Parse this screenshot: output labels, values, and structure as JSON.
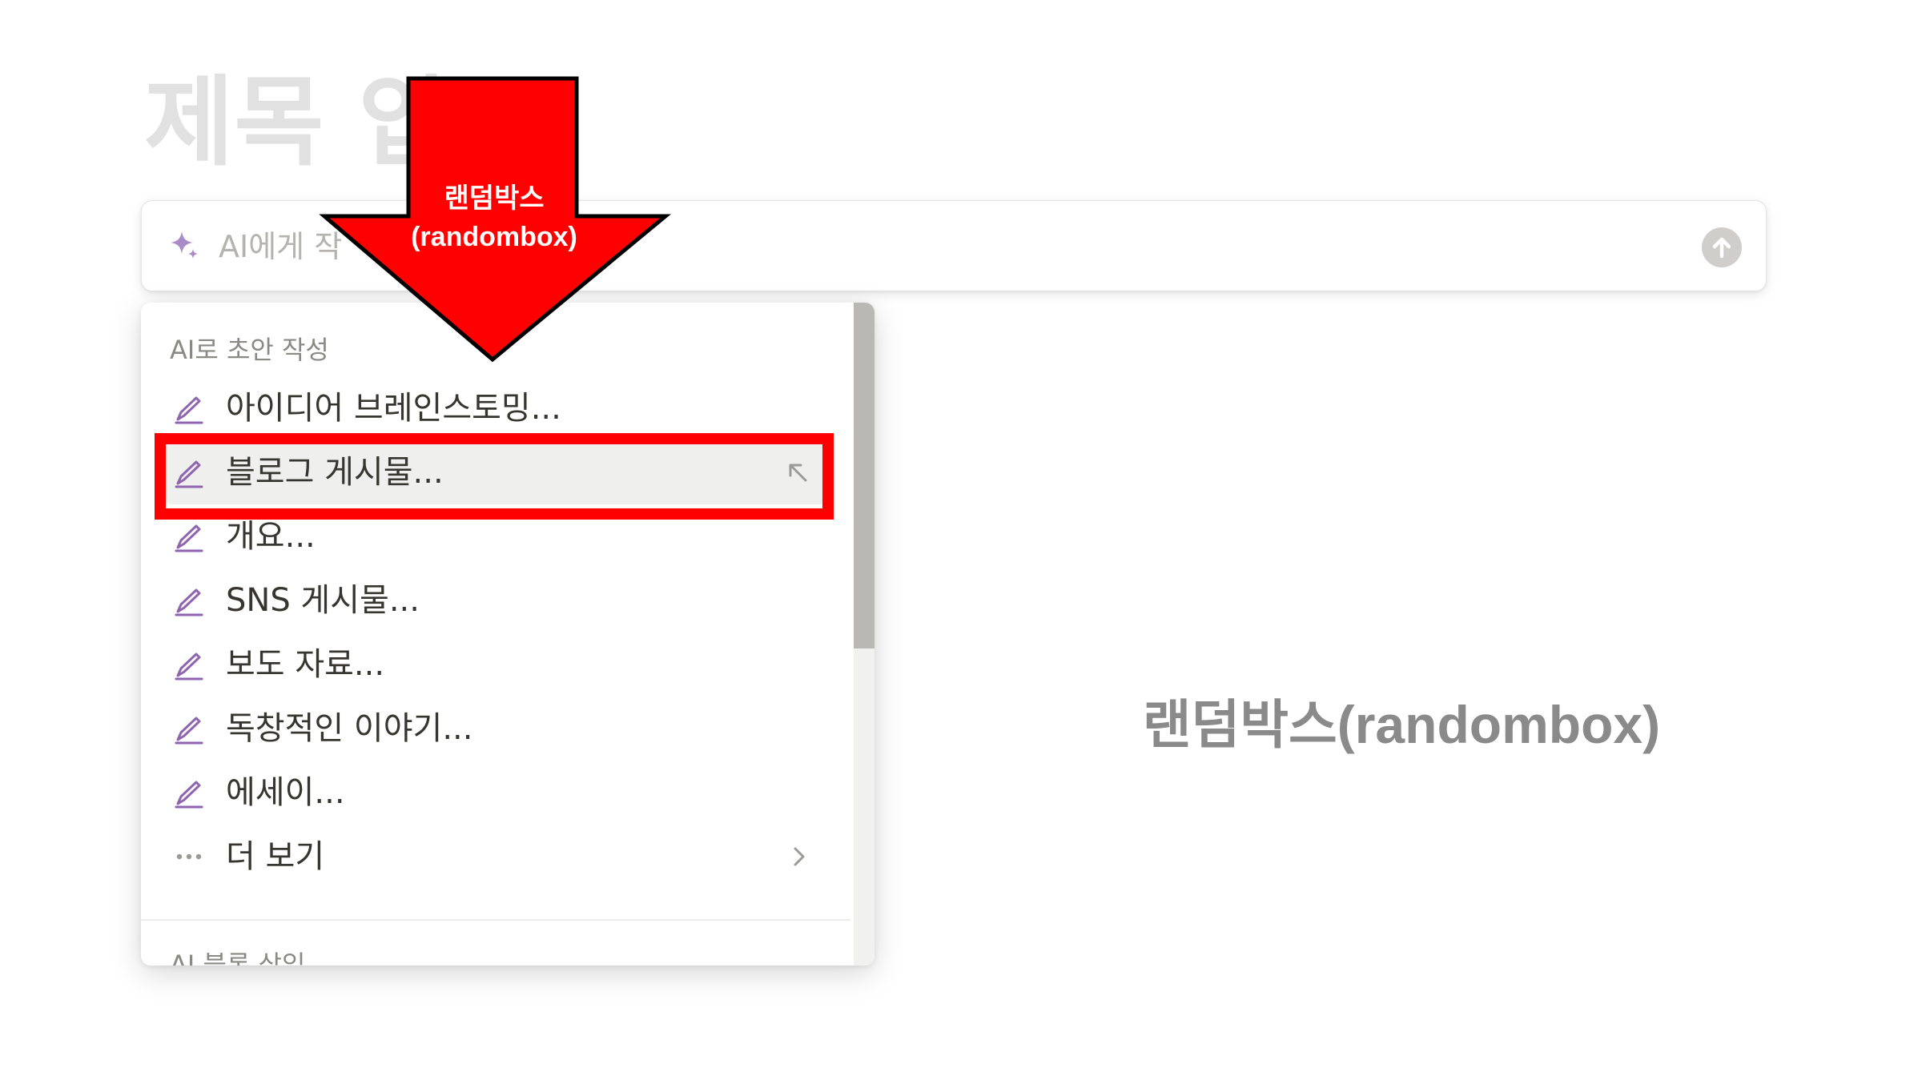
{
  "page": {
    "title": "제목 입"
  },
  "ai_bar": {
    "placeholder": "AI에게 작",
    "sparkle_icon": "sparkle-icon",
    "send_icon": "arrow-up-circle-icon",
    "accent_color": "#9065b0"
  },
  "menu": {
    "section_title": "AI로 초안 작성",
    "items": [
      {
        "label": "아이디어 브레인스토밍...",
        "icon": "pencil-icon"
      },
      {
        "label": "블로그 게시물...",
        "icon": "pencil-icon",
        "active": true
      },
      {
        "label": "개요...",
        "icon": "pencil-icon"
      },
      {
        "label": "SNS 게시물...",
        "icon": "pencil-icon"
      },
      {
        "label": "보도 자료...",
        "icon": "pencil-icon"
      },
      {
        "label": "독창적인 이야기...",
        "icon": "pencil-icon"
      },
      {
        "label": "에세이...",
        "icon": "pencil-icon"
      },
      {
        "label": "더 보기",
        "icon": "ellipsis-icon"
      }
    ],
    "section_title_2": "AI 블록 삽입"
  },
  "annotation": {
    "arrow_line1": "랜덤박스",
    "arrow_line2": "(randombox)",
    "color": "#ff0000"
  },
  "watermark": {
    "text": "랜덤박스(randombox)"
  }
}
